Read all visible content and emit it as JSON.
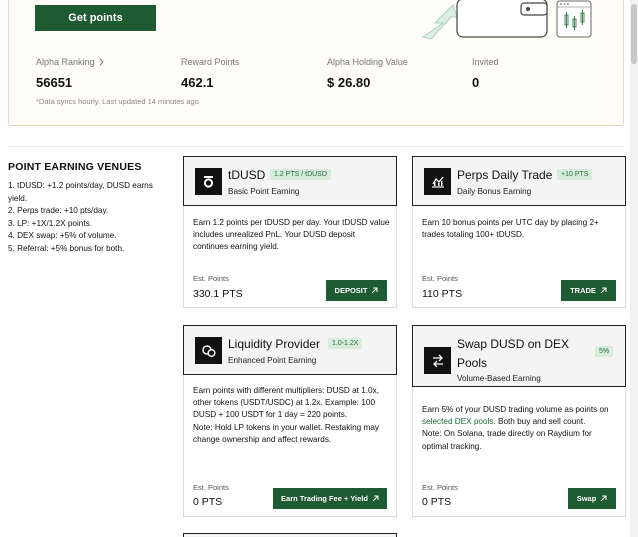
{
  "hero": {
    "get_points_label": "Get points",
    "stats": [
      {
        "label": "Alpha Ranking",
        "value": "56651"
      },
      {
        "label": "Reward Points",
        "value": "462.1"
      },
      {
        "label": "Alpha Holding Value",
        "value": "$ 26.80"
      },
      {
        "label": "Invited",
        "value": "0"
      }
    ],
    "sync_note": "*Data syncs hourly. Last updated 14 minutes ago"
  },
  "venues": {
    "title": "POINT EARNING VENUES",
    "items": [
      "1. tDUSD: +1.2 points/day, DUSD earns yield.",
      "2. Perps trade: +10 pts/day.",
      "3. LP: +1X/1.2X points.",
      "4. DEX swap: +5% of volume.",
      "5. Referral: +5% bonus for both."
    ]
  },
  "cards": [
    {
      "icon": "tdusd-coin-icon",
      "title": "tDUSD",
      "tag": "1.2 PTS / tDUSD",
      "subtitle": "Basic Point Earning",
      "desc": "Earn 1.2 points per tDUSD per day. Your tDUSD value includes unrealized PnL. Your DUSD deposit continues earning yield.",
      "est_label": "Est. Points",
      "est_value": "330.1 PTS",
      "action": "DEPOSIT"
    },
    {
      "icon": "perps-chart-icon",
      "title": "Perps Daily Trade",
      "tag": "+10 PTS",
      "subtitle": "Daily Bonus Earning",
      "desc": "Earn 10 bonus points per UTC day by placing 2+ trades totaling 100+ tDUSD.",
      "est_label": "Est. Points",
      "est_value": "110 PTS",
      "action": "TRADE"
    },
    {
      "icon": "liquidity-coins-icon",
      "title": "Liquidity Provider",
      "tag": "1.0-1.2X",
      "subtitle": "Enhanced Point Earning",
      "desc": "Earn points with different multipliers: DUSD at 1.0x, other tokens (USDT/USDC) at 1.2x. Example: 100 DUSD + 100 USDT for 1 day = 220 points.",
      "note": "Note: Hold LP tokens in your wallet. Restaking may change ownership and affect rewards.",
      "est_label": "Est. Points",
      "est_value": "0 PTS",
      "action": "Earn Trading Fee + Yield"
    },
    {
      "icon": "swap-arrows-icon",
      "title": "Swap DUSD on DEX Pools",
      "tag": "5%",
      "subtitle": "Volume-Based Earning",
      "desc_prefix": "Earn 5% of your DUSD trading volume as points on ",
      "desc_link": "selected DEX pools",
      "desc_suffix": ". Both buy and sell count.",
      "note": "Note: On Solana, trade directly on Raydium for optimal tracking.",
      "est_label": "Est. Points",
      "est_value": "0 PTS",
      "action": "Swap"
    }
  ]
}
